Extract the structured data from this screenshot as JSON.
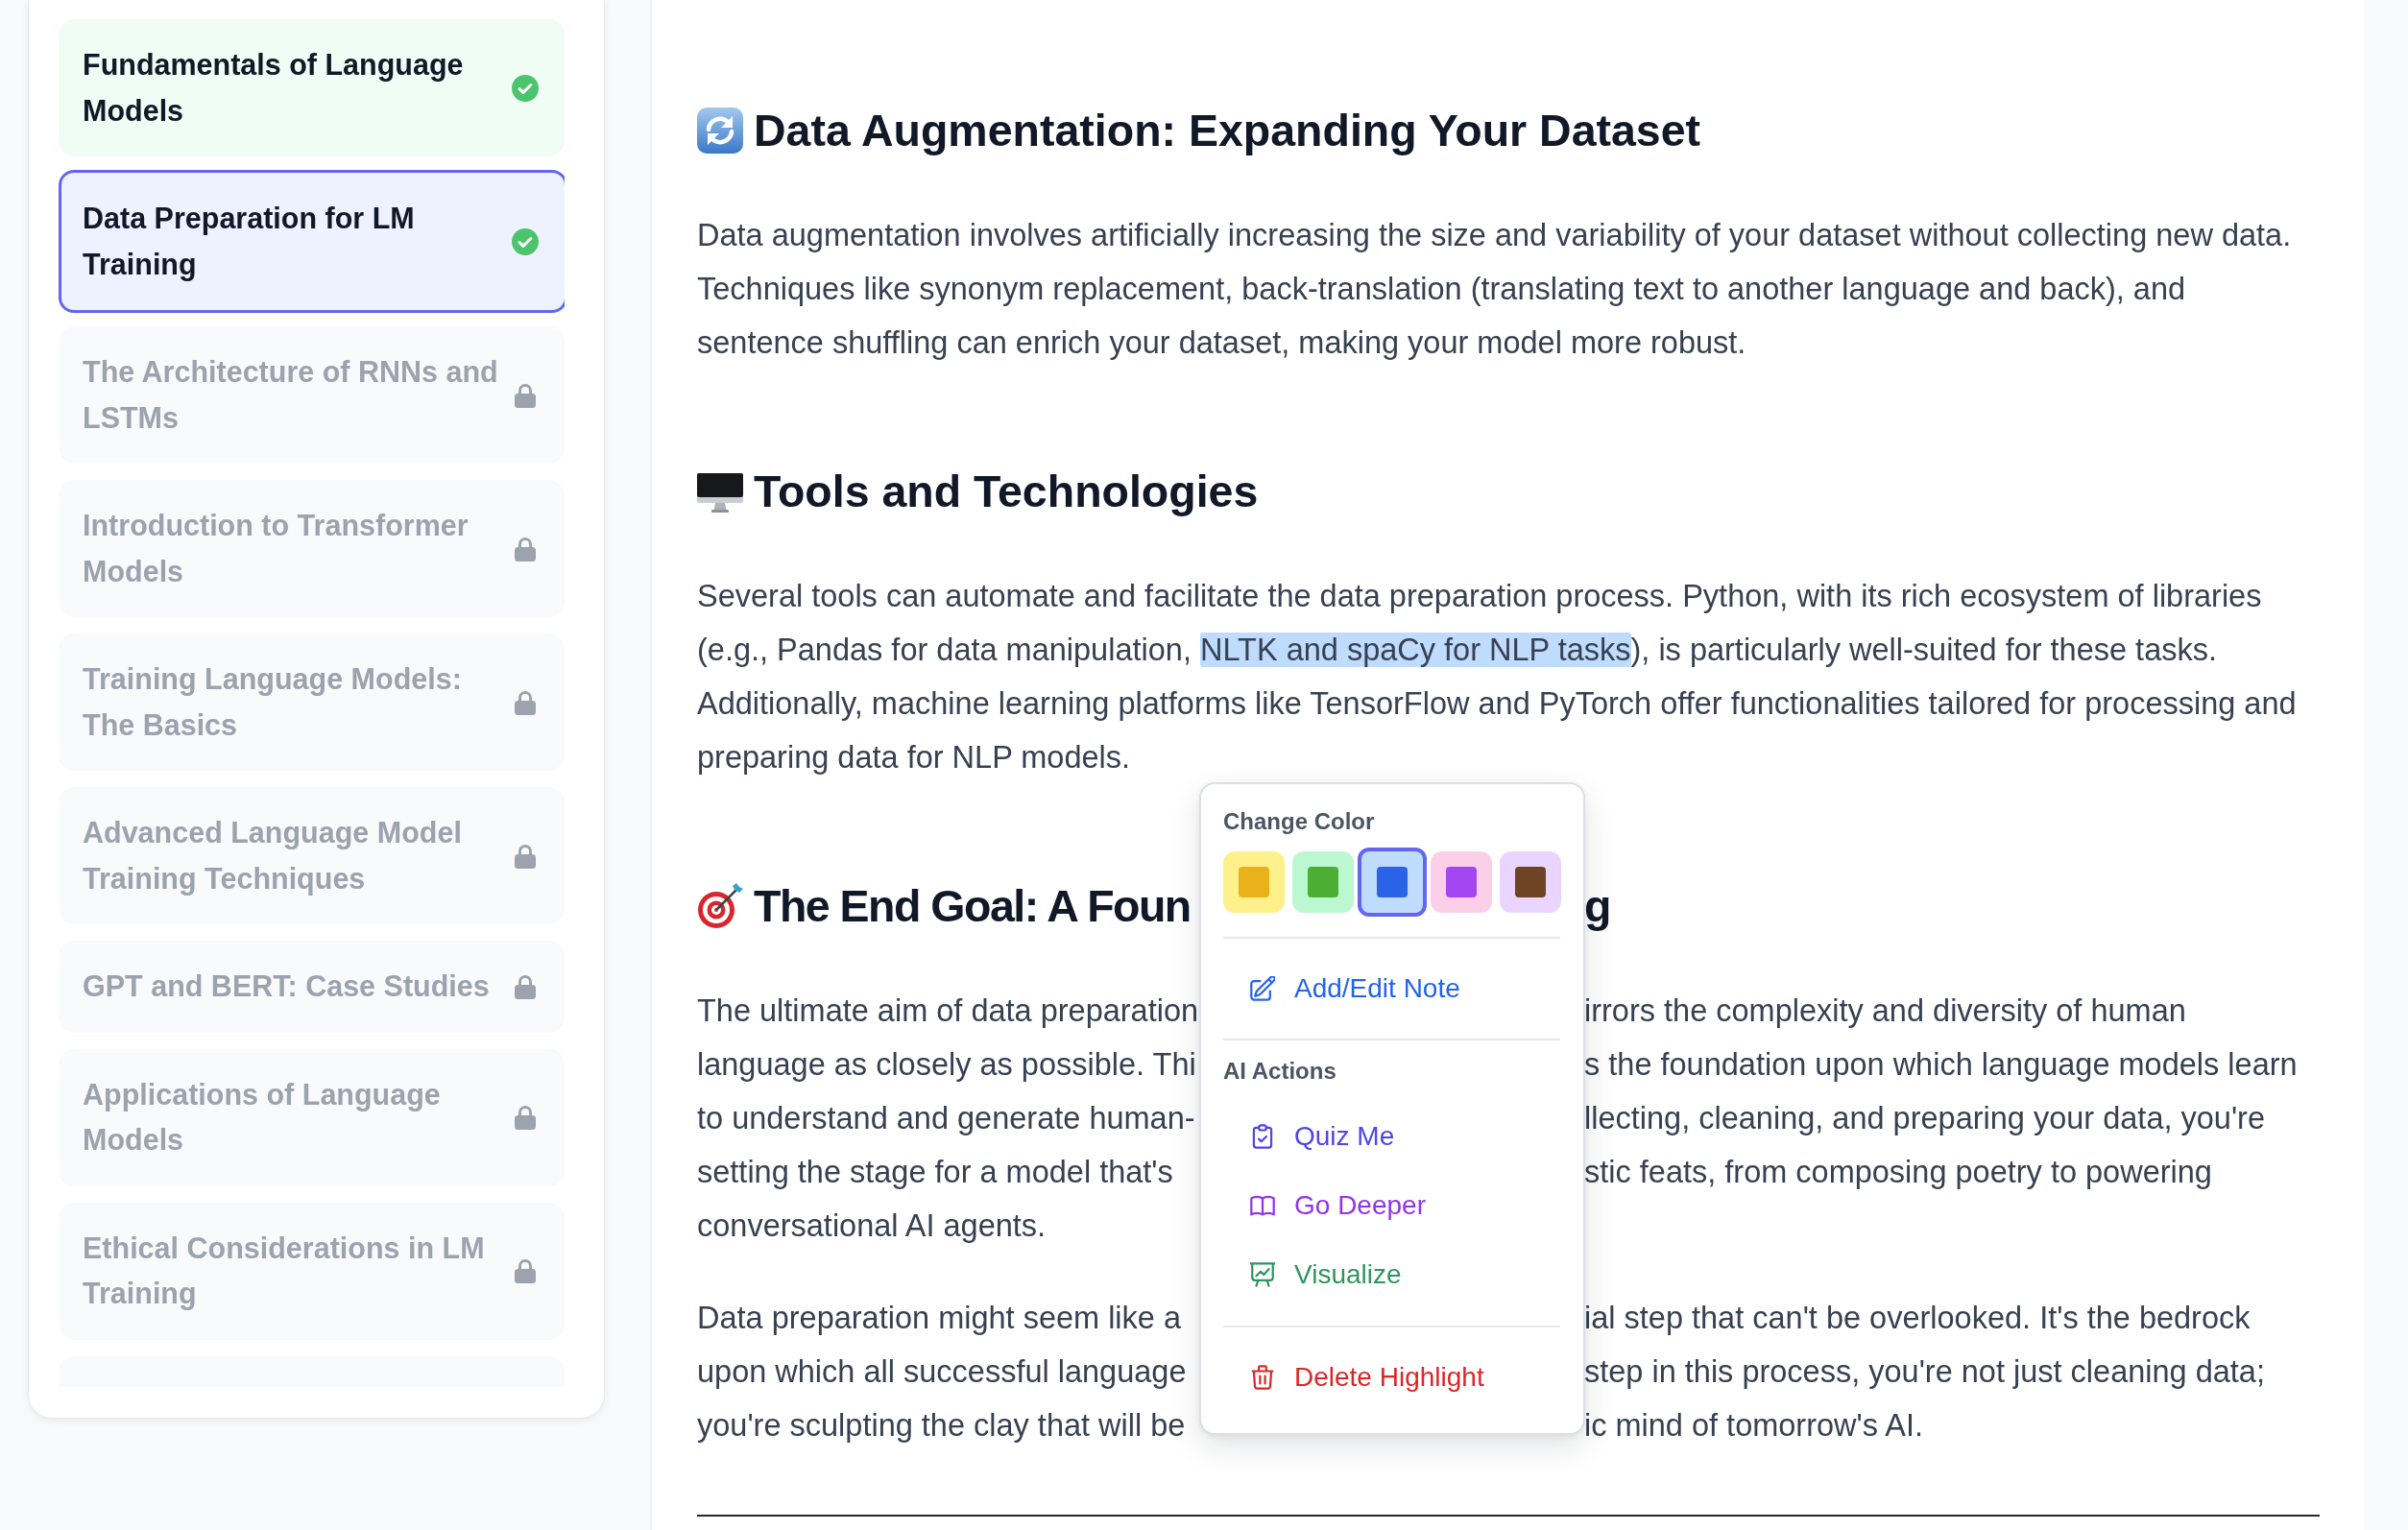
{
  "sidebar": {
    "lessons": [
      {
        "title": "Fundamentals of Language Models",
        "completed": true,
        "locked": false,
        "selected": false
      },
      {
        "title": "Data Preparation for LM Training",
        "completed": true,
        "locked": false,
        "selected": true
      },
      {
        "title": "The Architecture of RNNs and LSTMs",
        "completed": false,
        "locked": true,
        "selected": false
      },
      {
        "title": "Introduction to Transformer Models",
        "completed": false,
        "locked": true,
        "selected": false
      },
      {
        "title": "Training Language Models: The Basics",
        "completed": false,
        "locked": true,
        "selected": false
      },
      {
        "title": "Advanced Language Model Training Techniques",
        "completed": false,
        "locked": true,
        "selected": false
      },
      {
        "title": "GPT and BERT: Case Studies",
        "completed": false,
        "locked": true,
        "selected": false
      },
      {
        "title": "Applications of Language Models",
        "completed": false,
        "locked": true,
        "selected": false
      },
      {
        "title": "Ethical Considerations in LM Training",
        "completed": false,
        "locked": true,
        "selected": false
      }
    ]
  },
  "article": {
    "sections": [
      {
        "kind": "cycle",
        "heading": [
          "Data Augmentation: Expanding Your Dataset"
        ],
        "paragraphs": [
          {
            "kind": "flow",
            "segments": [
              {
                "text": "Data augmentation involves artificially increasing the size and variability of your dataset without collecting new data. Techniques like synonym replacement, back-translation (translating text to another language and back), and sentence shuffling can enrich your dataset, making your model more robust.",
                "highlighted": false
              }
            ]
          }
        ]
      },
      {
        "kind": "monitor",
        "heading": [
          "Tools and Technologies"
        ],
        "paragraphs": [
          {
            "kind": "flow",
            "segments": [
              {
                "text": "Several tools can automate and facilitate the data preparation process. Python, with its rich ecosystem of libraries (e.g., Pandas for data manipulation, ",
                "highlighted": false
              },
              {
                "text": "NLTK and spaCy for NLP tasks",
                "highlighted": true
              },
              {
                "text": "), is particularly well-suited for these tasks. Additionally, machine learning platforms like TensorFlow and PyTorch offer functionalities tailored for processing and preparing data for NLP models.",
                "highlighted": false
              }
            ]
          }
        ]
      },
      {
        "kind": "target",
        "heading": [
          "The End Goal: A Foun",
          "g"
        ],
        "paragraphs": [
          {
            "kind": "lines",
            "lines": [
              [
                "The ultimate aim of data preparation",
                "irrors the complexity and diversity of human"
              ],
              [
                "language as closely as possible. Thi",
                "s the foundation upon which language models learn"
              ],
              [
                "to understand and generate human-",
                "llecting, cleaning, and preparing your data, you're"
              ],
              [
                "setting the stage for a model that's",
                "stic feats, from composing poetry to powering"
              ],
              [
                "conversational AI agents."
              ]
            ]
          },
          {
            "kind": "lines",
            "lines": [
              [
                "Data preparation might seem like a",
                "ial step that can't be overlooked. It's the bedrock"
              ],
              [
                "upon which all successful language",
                "step in this process, you're not just cleaning data;"
              ],
              [
                "you're sculpting the clay that will be",
                "ic mind of tomorrow's AI."
              ]
            ]
          }
        ]
      }
    ]
  },
  "highlight_menu": {
    "sections": [
      {
        "kind": "colors",
        "title": "Change Color",
        "swatches": [
          {
            "kind": "yellow",
            "color": "#fef08a",
            "selected": false
          },
          {
            "kind": "green",
            "color": "#bbf7d0",
            "selected": false
          },
          {
            "kind": "blue",
            "color": "#bfdbfe",
            "selected": true
          },
          {
            "kind": "purple",
            "color": "#fbcfe8",
            "selected": false
          },
          {
            "kind": "brown",
            "color": "#e9d5ff",
            "selected": false
          }
        ]
      },
      {
        "kind": "actions",
        "items": [
          {
            "kind": "note",
            "label": "Add/Edit Note",
            "color": "#2563eb"
          }
        ]
      },
      {
        "kind": "actions",
        "title": "AI Actions",
        "items": [
          {
            "kind": "quiz",
            "label": "Quiz Me",
            "color": "#4f46e5"
          },
          {
            "kind": "deeper",
            "label": "Go Deeper",
            "color": "#9333ea"
          },
          {
            "kind": "visualize",
            "label": "Visualize",
            "color": "#2f945f"
          }
        ]
      },
      {
        "kind": "actions",
        "items": [
          {
            "kind": "delete",
            "label": "Delete Highlight",
            "color": "#dc2626"
          }
        ]
      }
    ]
  }
}
